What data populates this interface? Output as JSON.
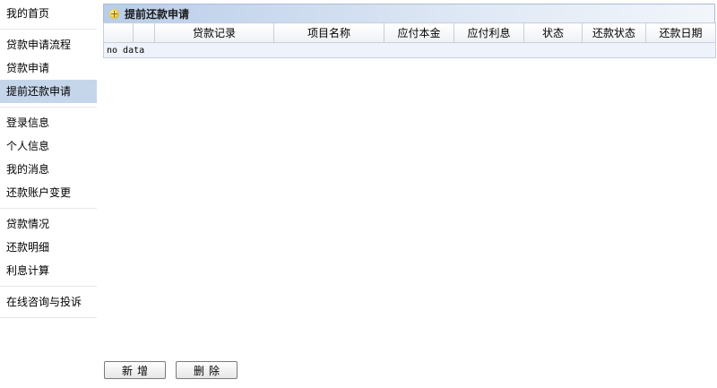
{
  "sidebar": {
    "groups": [
      {
        "items": [
          "我的首页"
        ]
      },
      {
        "items": [
          "贷款申请流程",
          "贷款申请",
          "提前还款申请"
        ]
      },
      {
        "items": [
          "登录信息",
          "个人信息",
          "我的消息",
          "还款账户变更"
        ]
      },
      {
        "items": [
          "贷款情况",
          "还款明细",
          "利息计算"
        ]
      },
      {
        "items": [
          "在线咨询与投诉"
        ]
      }
    ],
    "active_item": "提前还款申请"
  },
  "panel": {
    "title": "提前还款申请",
    "icon": "add-circle-icon"
  },
  "table": {
    "columns": [
      "",
      "",
      "贷款记录",
      "项目名称",
      "应付本金",
      "应付利息",
      "状态",
      "还款状态",
      "还款日期"
    ],
    "empty_text": "no data"
  },
  "buttons": {
    "add_label": "新增",
    "delete_label": "删除"
  },
  "colors": {
    "active_nav_bg": "#c6d6ea",
    "header_gradient_start": "#b9cde8",
    "empty_row_bg": "#eef2fa"
  }
}
